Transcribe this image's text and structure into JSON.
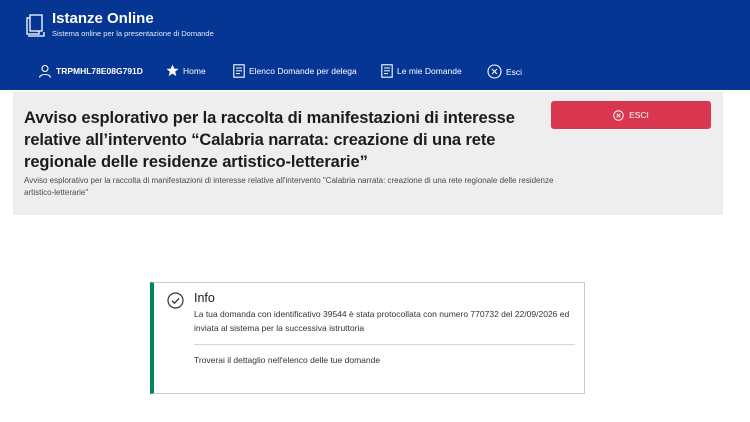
{
  "header": {
    "title": "Istanze Online",
    "subtitle": "Sistema online per la presentazione di Domande",
    "logo_icon": "document-icon",
    "background_color": "#063694"
  },
  "nav": {
    "user_code": "TRPMHL78E08G791D",
    "items": [
      {
        "label": "Home",
        "icon": "star-icon"
      },
      {
        "label": "Elenco Domande per delega",
        "icon": "document-list-icon"
      },
      {
        "label": "Le mie Domande",
        "icon": "document-list-icon"
      },
      {
        "label": "Esci",
        "icon": "close-circle-icon"
      }
    ]
  },
  "hero": {
    "title": "Avviso esplorativo per la raccolta di manifestazioni di interesse relative all’intervento “Calabria narrata: creazione di una rete regionale delle residenze artistico-letterarie”",
    "description": "Avviso esplorativo per la raccolta di manifestazioni di interesse relative all'intervento \"Calabria narrata: creazione di una rete regionale delle residenze artistico-letterarie\"",
    "exit_button_label": "ESCI",
    "exit_button_color": "#d9364f"
  },
  "info": {
    "title": "Info",
    "message": "La tua domanda con identificativo 39544 è stata protocollata con numero 770732 del 22/09/2026 ed inviata al sistema per la successiva istruttoria",
    "detail": "Troverai il dettaglio nell'elenco delle tue domande",
    "accent_color": "#008758",
    "icon": "check-circle-icon"
  }
}
